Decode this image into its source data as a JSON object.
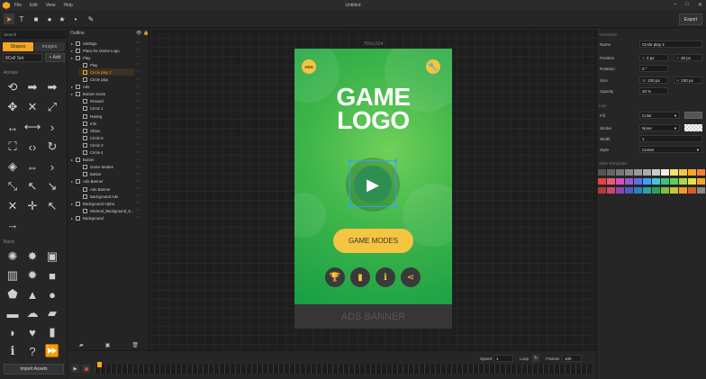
{
  "menubar": {
    "items": [
      "File",
      "Edit",
      "View",
      "Help"
    ],
    "title": "Untitled"
  },
  "toolbar": {
    "export_label": "Export"
  },
  "leftpanel": {
    "search_placeholder": "Search",
    "tabs": [
      "Shapes",
      "Images"
    ],
    "set_select": "8Cell Set",
    "add_label": "+ Add",
    "sections": [
      "Arrows",
      "Basic"
    ],
    "import_label": "Import Assets"
  },
  "outline": {
    "header": "Outline",
    "rows": [
      {
        "label": "Settings",
        "level": 0
      },
      {
        "label": "Place for Game Logo",
        "level": 0
      },
      {
        "label": "Play",
        "level": 0
      },
      {
        "label": "Play",
        "level": 1
      },
      {
        "label": "Circle play 2",
        "level": 1
      },
      {
        "label": "Circle play",
        "level": 1
      },
      {
        "label": "Ads",
        "level": 0
      },
      {
        "label": "Bottom Icons",
        "level": 0
      },
      {
        "label": "Reward",
        "level": 1
      },
      {
        "label": "Circle 1",
        "level": 1
      },
      {
        "label": "Raiting",
        "level": 1
      },
      {
        "label": "Info",
        "level": 1
      },
      {
        "label": "Share",
        "level": 1
      },
      {
        "label": "Circle 0",
        "level": 1
      },
      {
        "label": "Circle 3",
        "level": 1
      },
      {
        "label": "Circle 4",
        "level": 1
      },
      {
        "label": "Button",
        "level": 0
      },
      {
        "label": "Game Modes",
        "level": 1
      },
      {
        "label": "Button",
        "level": 1
      },
      {
        "label": "Ads Banner",
        "level": 0
      },
      {
        "label": "Ads Banner",
        "level": 1
      },
      {
        "label": "Background Ads",
        "level": 1
      },
      {
        "label": "Background Alpha",
        "level": 0
      },
      {
        "label": "Minimal_Background_5...",
        "level": 1
      },
      {
        "label": "Background",
        "level": 0
      }
    ],
    "selected": "Circle play 2"
  },
  "canvas": {
    "size_label": "750x1334",
    "logo_line1": "GAME",
    "logo_line2": "LOGO",
    "ads_icon_text": "ADS",
    "game_modes_label": "GAME MODES",
    "ads_banner_label": "ADS BANNER"
  },
  "inspector": {
    "transform_header": "Transform",
    "name_label": "Name",
    "name_value": "Circle play 2",
    "position_label": "Position",
    "pos_x": "0 px",
    "pos_y": "30 px",
    "rotation_label": "Rotation",
    "rotation_value": "0 °",
    "size_label": "Size",
    "size_w": "230 px",
    "size_h": "230 px",
    "opacity_label": "Opacity",
    "opacity_value": "20 %",
    "line_header": "Line",
    "fill_label": "Fill",
    "fill_value": "Color",
    "stroke_label": "Stroke",
    "stroke_value": "None",
    "width_label": "Width",
    "width_value": "1",
    "style_label": "Style",
    "style_value": "Center",
    "swatch_header": "Style Templates",
    "swatch_rows": [
      [
        "#555",
        "#666",
        "#777",
        "#888",
        "#999",
        "#aaa",
        "#ccc",
        "#eee",
        "#f5e06a",
        "#f5c542",
        "#f5a623",
        "#f57f3a"
      ],
      [
        "#e0443e",
        "#e85d75",
        "#d94fb8",
        "#9b59d0",
        "#5b6fe0",
        "#3aa0ff",
        "#3fc7d6",
        "#3fbf7f",
        "#5bd15a",
        "#a7d94a",
        "#e6e04a",
        "#f5a623"
      ],
      [
        "#b03a3a",
        "#c94a6a",
        "#8e44ad",
        "#4e5bc4",
        "#2a7fc4",
        "#2aa3a3",
        "#2f9f5f",
        "#7fbf3f",
        "#c4c43f",
        "#f59a23",
        "#d45f2a",
        "#888"
      ]
    ]
  },
  "timeline": {
    "speed_label": "Speed",
    "speed_value": "1",
    "loop_label": "Loop",
    "frames_label": "Frames",
    "frames_value": "100"
  }
}
